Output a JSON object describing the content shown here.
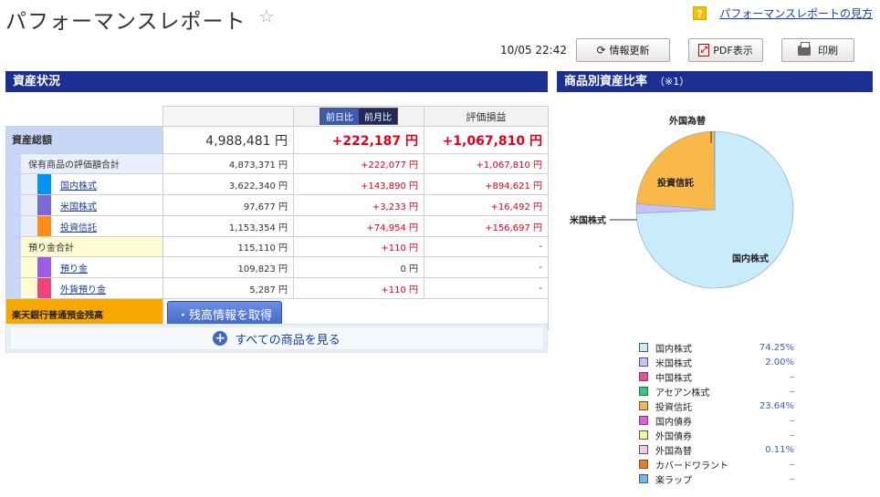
{
  "header": {
    "title": "パフォーマンスレポート",
    "help_icon": "?",
    "help_link": "パフォーマンスレポートの見方"
  },
  "toolbar": {
    "timestamp": "10/05 22:42",
    "refresh_label": "情報更新",
    "pdf_label": "PDF表示",
    "pdf_icon": "PDF-icon",
    "print_label": "印刷"
  },
  "assets": {
    "section_title": "資産状況",
    "toggle_day": "前日比",
    "toggle_month": "前月比",
    "col_pnl": "評価損益",
    "total": {
      "label": "資産総額",
      "amount": "4,988,481 円",
      "change": "+222,187 円",
      "pnl": "+1,067,810 円"
    },
    "holdings": {
      "label": "保有商品の評価額合計",
      "amount": "4,873,371 円",
      "change": "+222,077 円",
      "pnl": "+1,067,810 円"
    },
    "domestic": {
      "label": "国内株式",
      "amount": "3,622,340 円",
      "change": "+143,890 円",
      "pnl": "+894,621 円",
      "color": "#0094f0"
    },
    "us": {
      "label": "米国株式",
      "amount": "97,677 円",
      "change": "+3,233 円",
      "pnl": "+16,492 円",
      "color": "#7a6ad8"
    },
    "fund": {
      "label": "投資信託",
      "amount": "1,153,354 円",
      "change": "+74,954 円",
      "pnl": "+156,697 円",
      "color": "#ff8c1a"
    },
    "deposit_total": {
      "label": "預り金合計",
      "amount": "115,110 円",
      "change": "+110 円",
      "pnl": "-"
    },
    "deposit": {
      "label": "預り金",
      "amount": "109,823 円",
      "change": "0 円",
      "pnl": "-",
      "color": "#9b5ee0"
    },
    "fx_deposit": {
      "label": "外貨預り金",
      "amount": "5,287 円",
      "change": "+110 円",
      "pnl": "-",
      "color": "#f0437a"
    },
    "rakuten": {
      "label": "楽天銀行普通預金残高",
      "button": "残高情報を取得"
    },
    "show_all": "すべての商品を見る"
  },
  "allocation": {
    "section_title": "商品別資産比率",
    "note": "（※1）",
    "pie_labels": {
      "fx": "外国為替",
      "fund": "投資信託",
      "us": "米国株式",
      "domestic": "国内株式"
    },
    "legend": [
      {
        "name": "国内株式",
        "pct": "74.25%",
        "color": "#c9ecfd"
      },
      {
        "name": "米国株式",
        "pct": "2.00%",
        "color": "#c3c3f5"
      },
      {
        "name": "中国株式",
        "pct": "–",
        "color": "#f04aa0"
      },
      {
        "name": "アセアン株式",
        "pct": "–",
        "color": "#1ed27c"
      },
      {
        "name": "投資信託",
        "pct": "23.64%",
        "color": "#f8b84a"
      },
      {
        "name": "国内債券",
        "pct": "–",
        "color": "#ee58dd"
      },
      {
        "name": "外国債券",
        "pct": "–",
        "color": "#f5f59a"
      },
      {
        "name": "外国為替",
        "pct": "0.11%",
        "color": "#f3c8f5"
      },
      {
        "name": "カバードワラント",
        "pct": "–",
        "color": "#f47a1a"
      },
      {
        "name": "楽ラップ",
        "pct": "–",
        "color": "#6fb8f0"
      }
    ]
  },
  "chart_data": {
    "type": "pie",
    "categories": [
      "国内株式",
      "米国株式",
      "投資信託",
      "外国為替"
    ],
    "values": [
      74.25,
      2.0,
      23.64,
      0.11
    ],
    "colors": [
      "#c9ecfd",
      "#c3c3f5",
      "#f8b84a",
      "#f3c8f5"
    ]
  }
}
